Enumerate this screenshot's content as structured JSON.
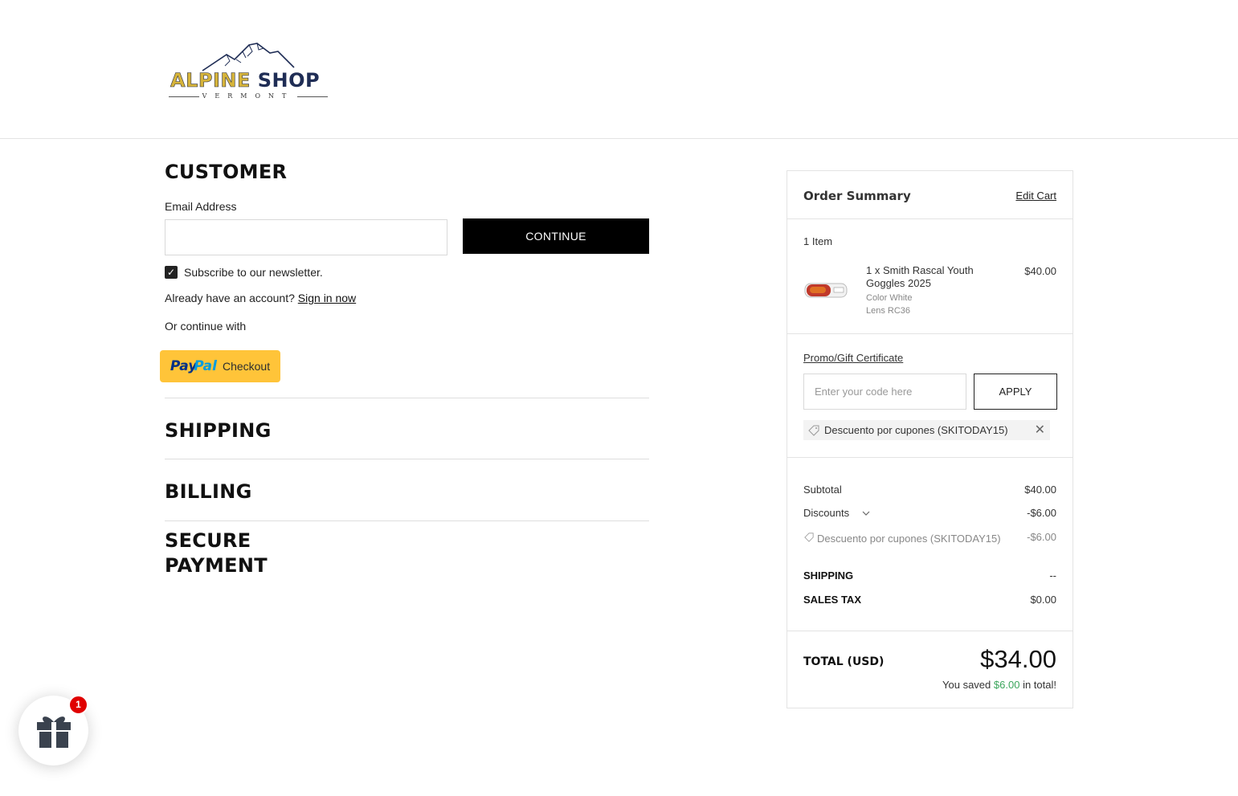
{
  "brand": {
    "name_part1": "ALPINE",
    "name_part2": "SHOP",
    "subtitle": "VERMONT",
    "colors": {
      "gold": "#d6b43a",
      "navy": "#1f2d55"
    }
  },
  "customer": {
    "title": "CUSTOMER",
    "email_label": "Email Address",
    "email_value": "",
    "continue_label": "CONTINUE",
    "newsletter_label": "Subscribe to our newsletter.",
    "newsletter_checked": true,
    "account_prompt": "Already have an account?",
    "sign_in_label": "Sign in now",
    "or_continue": "Or continue with",
    "paypal": {
      "pay": "Pay",
      "pal": "Pal",
      "checkout": "Checkout"
    }
  },
  "steps": {
    "shipping": "SHIPPING",
    "billing": "BILLING",
    "payment_line1": "SECURE",
    "payment_line2": "PAYMENT"
  },
  "summary": {
    "title": "Order Summary",
    "edit_cart": "Edit Cart",
    "item_count": "1 Item",
    "item": {
      "name": "1 x Smith Rascal Youth Goggles 2025",
      "color": "Color White",
      "lens": "Lens RC36",
      "price": "$40.00"
    },
    "promo_label": "Promo/Gift Certificate",
    "promo_placeholder": "Enter your code here",
    "apply_label": "APPLY",
    "coupon_chip": "Descuento por cupones (SKITODAY15)",
    "subtotal_label": "Subtotal",
    "subtotal_value": "$40.00",
    "discounts_label": "Discounts",
    "discounts_value": "-$6.00",
    "coupon_line_label": "Descuento por cupones (SKITODAY15)",
    "coupon_line_value": "-$6.00",
    "shipping_label": "SHIPPING",
    "shipping_value": "--",
    "tax_label": "SALES TAX",
    "tax_value": "$0.00",
    "total_label": "TOTAL (USD)",
    "total_value": "$34.00",
    "saved_prefix": "You saved",
    "saved_amount": "$6.00",
    "saved_suffix": "in total!"
  },
  "gift_widget": {
    "badge_count": "1"
  }
}
